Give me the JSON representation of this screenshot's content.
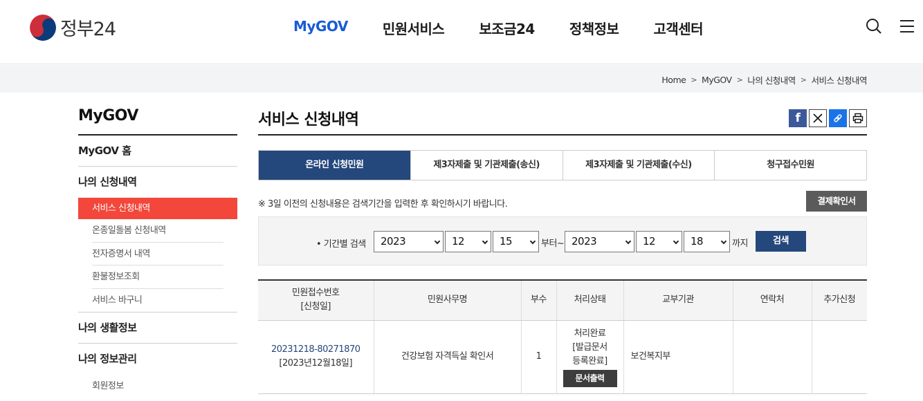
{
  "header": {
    "logo_text": "정부24",
    "nav": [
      "MyGOV",
      "민원서비스",
      "보조금24",
      "정책정보",
      "고객센터"
    ],
    "active_nav": "MyGOV",
    "icons": [
      "search-icon",
      "menu-icon"
    ]
  },
  "breadcrumb": [
    "Home",
    "MyGOV",
    "나의 신청내역",
    "서비스 신청내역"
  ],
  "sidebar": {
    "title": "MyGOV",
    "home": "MyGOV 홈",
    "group1": "나의 신청내역",
    "group1_items": [
      "서비스 신청내역",
      "온종일돌봄 신청내역",
      "전자증명서 내역",
      "환불정보조회",
      "서비스 바구니"
    ],
    "group2": "나의 생활정보",
    "group3": "나의 정보관리",
    "group3_items": [
      "회원정보"
    ]
  },
  "content": {
    "title": "서비스 신청내역",
    "share_icons": [
      "facebook-icon",
      "x-icon",
      "link-icon",
      "print-icon"
    ],
    "tabs": [
      "온라인 신청민원",
      "제3자제출 및 기관제출(송신)",
      "제3자제출 및 기관제출(수신)",
      "청구접수민원"
    ],
    "notice": "※ 3일 이전의 신청내용은 검색기간을 입력한 후 확인하시기 바랍니다.",
    "receipt_button": "결제확인서",
    "search": {
      "label": "• 기간별 검색",
      "from": {
        "year": "2023",
        "month": "12",
        "day": "15"
      },
      "from_suffix": "부터~",
      "to": {
        "year": "2023",
        "month": "12",
        "day": "18"
      },
      "to_suffix": "까지",
      "button": "검색"
    },
    "table": {
      "headers": [
        "민원접수번호",
        "[신청일]",
        "민원사무명",
        "부수",
        "처리상태",
        "교부기관",
        "연락처",
        "추가신청"
      ],
      "rows": [
        {
          "receipt_no": "20231218-80271870",
          "date": "[2023년12월18일]",
          "name": "건강보험 자격득실 확인서",
          "copies": "1",
          "status1": "처리완료",
          "status2": "[발급문서",
          "status3": "등록완료]",
          "print_button": "문서출력",
          "agency": "보건복지부",
          "contact": "",
          "extra": ""
        }
      ]
    }
  },
  "colors": {
    "accent_blue": "#1a5bd6",
    "navy": "#24477c",
    "sidebar_active": "#f2473a"
  }
}
